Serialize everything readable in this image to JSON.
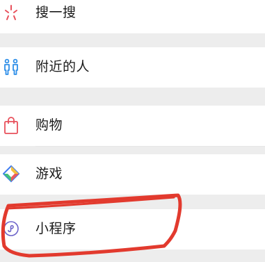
{
  "menu": {
    "items": [
      {
        "label": "搜一搜",
        "icon": "search-spark-icon"
      },
      {
        "label": "附近的人",
        "icon": "people-nearby-icon"
      },
      {
        "label": "购物",
        "icon": "shopping-bag-icon"
      },
      {
        "label": "游戏",
        "icon": "game-diamond-icon"
      },
      {
        "label": "小程序",
        "icon": "mini-program-icon"
      }
    ]
  },
  "colors": {
    "background": "#ededed",
    "row": "#ffffff",
    "text": "#1a1a1a",
    "search_icon": "#e8505b",
    "people_icon": "#2f8fe8",
    "shopping_icon": "#e8505b",
    "game_blue": "#3e7bf0",
    "game_green": "#42c07d",
    "game_yellow": "#f3c03c",
    "game_red": "#e95b5b",
    "mini_program_icon": "#6c63c9",
    "annotation_stroke": "#e23a2e"
  }
}
